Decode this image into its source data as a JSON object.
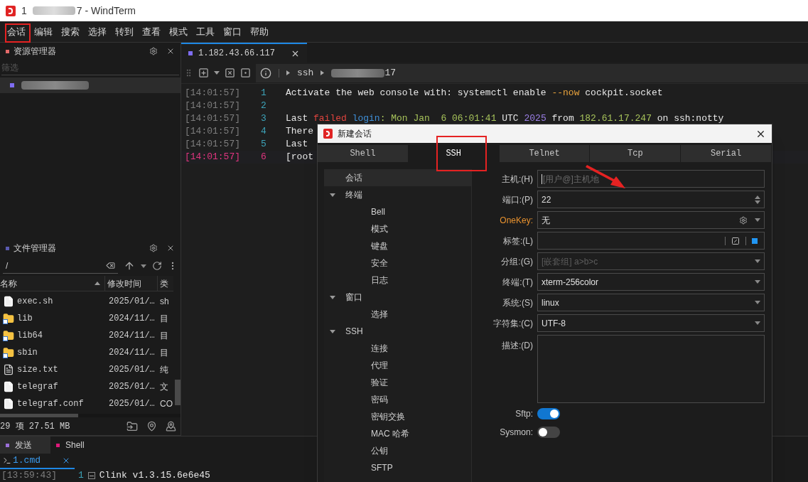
{
  "window": {
    "title_prefix": "1",
    "title_suffix": "7 - WindTerm"
  },
  "menu": [
    "会话",
    "编辑",
    "搜索",
    "选择",
    "转到",
    "查看",
    "模式",
    "工具",
    "窗口",
    "帮助"
  ],
  "resource_manager": {
    "title": "资源管理器",
    "filter_placeholder": "筛选",
    "items": [
      {
        "selected": true,
        "color": "#7f6df2"
      }
    ]
  },
  "session_tab": {
    "label": "1.182.43.66.117",
    "color": "#7f6df2",
    "selected": true
  },
  "breadcrumb": {
    "protocol": "ssh",
    "host_suffix": "17"
  },
  "terminal_lines": [
    {
      "time": "[14:01:57]",
      "number": "1",
      "current": false,
      "segments": [
        {
          "text": "Activate the web console with: systemctl enable ",
          "color": "#e6e6e6"
        },
        {
          "text": "--now",
          "color": "#e8a33d"
        },
        {
          "text": " cockpit.socket",
          "color": "#e6e6e6"
        }
      ]
    },
    {
      "time": "[14:01:57]",
      "number": "2",
      "current": false
    },
    {
      "time": "[14:01:57]",
      "number": "3",
      "current": false,
      "segments": [
        {
          "text": "Last ",
          "color": "#e6e6e6"
        },
        {
          "text": "failed",
          "color": "#e0443e"
        },
        {
          "text": " login",
          "color": "#3f8fd8"
        },
        {
          "text": ": Mon Jan  6 06:01:41",
          "color": "#a6c25a"
        },
        {
          "text": " UTC ",
          "color": "#e6e6e6"
        },
        {
          "text": "2025",
          "color": "#9b7fe6"
        },
        {
          "text": " from ",
          "color": "#e6e6e6"
        },
        {
          "text": "182.61.17.247",
          "color": "#a6c25a"
        },
        {
          "text": " on ssh:notty",
          "color": "#e6e6e6"
        }
      ]
    },
    {
      "time": "[14:01:57]",
      "number": "4",
      "current": false,
      "segments": [
        {
          "text": "There",
          "color": "#e6e6e6"
        }
      ]
    },
    {
      "time": "[14:01:57]",
      "number": "5",
      "current": false,
      "segments": [
        {
          "text": "Last",
          "color": "#e6e6e6"
        }
      ]
    },
    {
      "time": "[14:01:57]",
      "number": "6",
      "current": true,
      "segments": [
        {
          "text": "[root",
          "color": "#e6e6e6"
        }
      ]
    }
  ],
  "file_manager": {
    "title": "文件管理器",
    "path": "/",
    "columns": [
      "名称",
      "修改时间",
      "类"
    ],
    "rows": [
      {
        "kind": "file",
        "name": "exec.sh",
        "modified": "2025/01/…",
        "type": "sh"
      },
      {
        "kind": "folder-link",
        "name": "lib",
        "modified": "2024/11/…",
        "type": "目"
      },
      {
        "kind": "folder-link",
        "name": "lib64",
        "modified": "2024/11/…",
        "type": "目"
      },
      {
        "kind": "folder-link",
        "name": "sbin",
        "modified": "2024/11/…",
        "type": "目"
      },
      {
        "kind": "text-file",
        "name": "size.txt",
        "modified": "2025/01/…",
        "type": "纯"
      },
      {
        "kind": "file",
        "name": "telegraf",
        "modified": "2025/01/…",
        "type": "文"
      },
      {
        "kind": "file",
        "name": "telegraf.conf",
        "modified": "2025/01/…",
        "type": "CO"
      }
    ],
    "status": "29 项 27.51 MB"
  },
  "bottom_panel": {
    "tabs": [
      {
        "label": "发送",
        "color": "#9b6fd9",
        "selected": true
      },
      {
        "label": "Shell",
        "color": "#e0187a",
        "selected": false
      }
    ],
    "sub_tab": {
      "label": "1.cmd",
      "selected": true
    },
    "line": {
      "time": "[13:59:43]",
      "number": "1",
      "text": "Clink v1.3.15.6e6e45"
    }
  },
  "dialog": {
    "title": "新建会话",
    "tabs": [
      {
        "label": "Shell",
        "selected": false
      },
      {
        "label": "SSH",
        "selected": true
      },
      {
        "label": "Telnet",
        "selected": false
      },
      {
        "label": "Tcp",
        "selected": false
      },
      {
        "label": "Serial",
        "selected": false
      }
    ],
    "tree": [
      {
        "label": "会话",
        "selected": true
      },
      {
        "label": "终端",
        "selected": false,
        "expanded": true,
        "children": [
          {
            "label": "Bell",
            "selected": false
          },
          {
            "label": "模式",
            "selected": false
          },
          {
            "label": "键盘",
            "selected": false
          },
          {
            "label": "安全",
            "selected": false
          },
          {
            "label": "日志",
            "selected": false
          }
        ]
      },
      {
        "label": "窗口",
        "selected": false,
        "expanded": true,
        "children": [
          {
            "label": "选择",
            "selected": false
          }
        ]
      },
      {
        "label": "SSH",
        "selected": false,
        "expanded": true,
        "children": [
          {
            "label": "连接",
            "selected": false
          },
          {
            "label": "代理",
            "selected": false
          },
          {
            "label": "验证",
            "selected": false
          },
          {
            "label": "密码",
            "selected": false
          },
          {
            "label": "密钥交换",
            "selected": false
          },
          {
            "label": "MAC 哈希",
            "selected": false
          },
          {
            "label": "公钥",
            "selected": false
          },
          {
            "label": "SFTP",
            "selected": false
          }
        ]
      }
    ],
    "fields": [
      {
        "kind": "text",
        "label": "主机:(H)",
        "placeholder": "[用户@]主机地",
        "focused": true
      },
      {
        "kind": "spin",
        "label": "端口:(P)",
        "value": "22"
      },
      {
        "kind": "select-gear",
        "label": "OneKey:",
        "accent": true,
        "value": "无"
      },
      {
        "kind": "tag",
        "label": "标签:(L)",
        "color": "#2196f3"
      },
      {
        "kind": "select",
        "label": "分组:(G)",
        "placeholder": "[嵌套组] a>b>c"
      },
      {
        "kind": "select",
        "label": "终端:(T)",
        "value": "xterm-256color"
      },
      {
        "kind": "select",
        "label": "系统:(S)",
        "value": "linux"
      },
      {
        "kind": "select",
        "label": "字符集:(C)",
        "value": "UTF-8"
      },
      {
        "kind": "textarea",
        "label": "描述:(D)"
      },
      {
        "kind": "switch",
        "label": "Sftp:",
        "on": true
      },
      {
        "kind": "switch",
        "label": "Sysmon:",
        "on": false
      }
    ]
  }
}
